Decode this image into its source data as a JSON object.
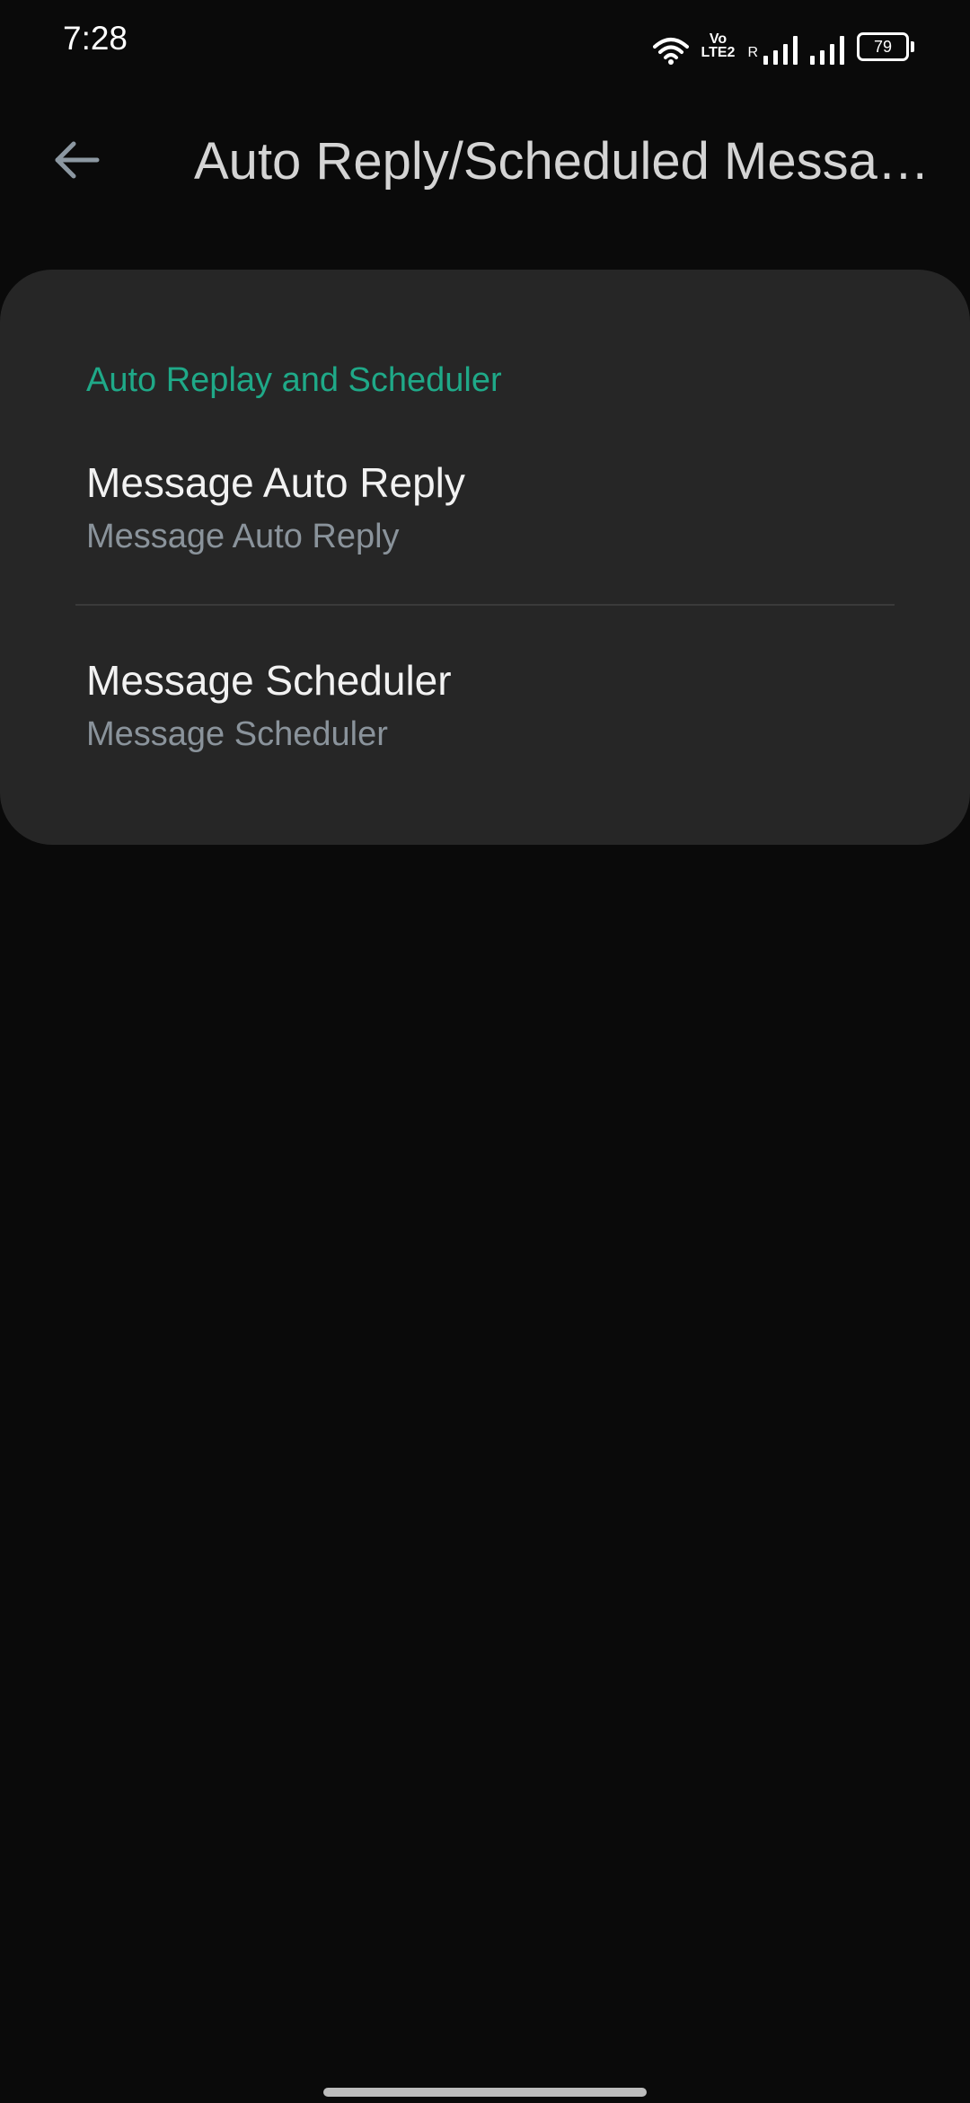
{
  "status_bar": {
    "time": "7:28",
    "volte_top": "Vo",
    "volte_bottom": "LTE2",
    "roaming": "R",
    "battery_level": "79",
    "icons": [
      "wifi-icon",
      "volte-icon",
      "signal-icon",
      "signal-icon",
      "battery-icon"
    ]
  },
  "app_bar": {
    "back_icon": "arrow-left-icon",
    "title": "Auto Reply/Scheduled Messages"
  },
  "settings": {
    "section_header": "Auto Replay and Scheduler",
    "items": [
      {
        "title": "Message Auto Reply",
        "summary": "Message Auto Reply"
      },
      {
        "title": "Message Scheduler",
        "summary": "Message Scheduler"
      }
    ]
  },
  "colors": {
    "background": "#0a0a0a",
    "card": "#262626",
    "accent": "#1fa988",
    "title_text": "#f2f2f2",
    "summary_text": "#8a939b"
  }
}
